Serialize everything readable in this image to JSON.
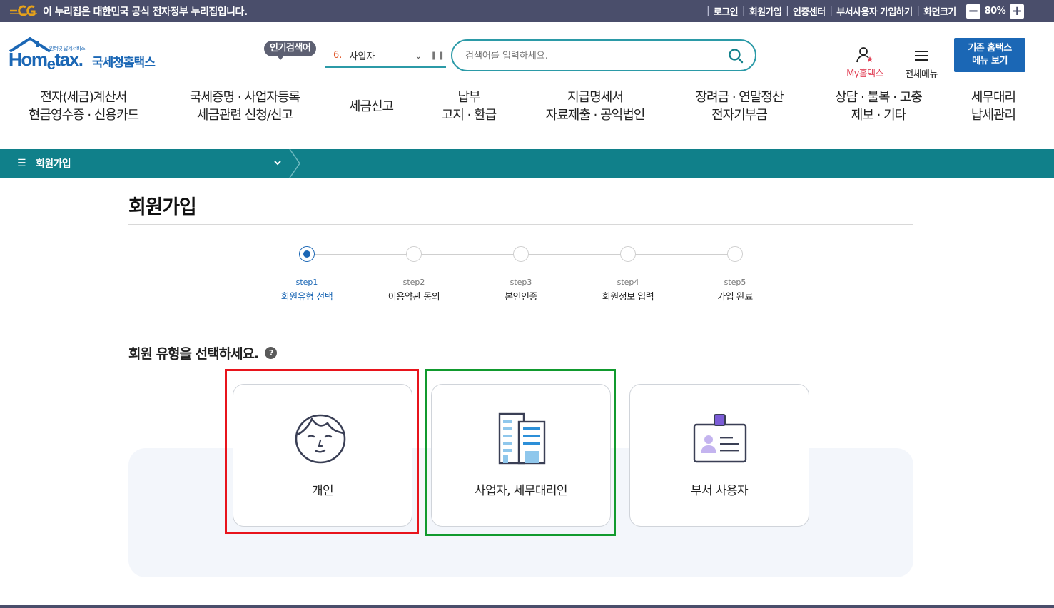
{
  "govbar": {
    "text": "이 누리집은 대한민국 공식 전자정부 누리집입니다.",
    "links": [
      "로그인",
      "회원가입",
      "인증센터",
      "부서사용자 가입하기",
      "화면크기"
    ],
    "zoom_minus": "−",
    "zoom_value": "80%",
    "zoom_plus": "+"
  },
  "logo": {
    "tagline": "인터넷 납세서비스",
    "brand_main": "Hom",
    "brand_e": "e",
    "brand_rest": "tax.",
    "brand_kor": "국세청홈택스"
  },
  "popular": {
    "badge": "인기검색어",
    "rank": "6.",
    "keyword": "사업자"
  },
  "search": {
    "placeholder": "검색어를 입력하세요."
  },
  "header": {
    "my_label": "My홈택스",
    "all_menu_label": "전체메뉴",
    "legacy_line1": "기존 홈택스",
    "legacy_line2": "메뉴 보기"
  },
  "gnb": [
    {
      "line1": "전자(세금)계산서",
      "line2": "현금영수증 · 신용카드"
    },
    {
      "line1": "국세증명 · 사업자등록",
      "line2": "세금관련 신청/신고"
    },
    {
      "line1": "세금신고",
      "line2": ""
    },
    {
      "line1": "납부",
      "line2": "고지 · 환급"
    },
    {
      "line1": "지급명세서",
      "line2": "자료제출 · 공익법인"
    },
    {
      "line1": "장려금 · 연말정산",
      "line2": "전자기부금"
    },
    {
      "line1": "상담 · 불복 · 고충",
      "line2": "제보 · 기타"
    },
    {
      "line1": "세무대리",
      "line2": "납세관리"
    }
  ],
  "location": {
    "current": "회원가입"
  },
  "page": {
    "title": "회원가입",
    "select_heading": "회원 유형을 선택하세요.",
    "help": "?"
  },
  "steps": [
    {
      "num": "step1",
      "name": "회원유형 선택",
      "active": true
    },
    {
      "num": "step2",
      "name": "이용약관 동의",
      "active": false
    },
    {
      "num": "step3",
      "name": "본인인증",
      "active": false
    },
    {
      "num": "step4",
      "name": "회원정보 입력",
      "active": false
    },
    {
      "num": "step5",
      "name": "가입 완료",
      "active": false
    }
  ],
  "cards": [
    {
      "label": "개인",
      "icon": "face-icon"
    },
    {
      "label": "사업자, 세무대리인",
      "icon": "building-icon"
    },
    {
      "label": "부서 사용자",
      "icon": "id-badge-icon"
    }
  ],
  "colors": {
    "govbar": "#4a4e6b",
    "teal": "#10808a",
    "brand_blue": "#1b67b5",
    "highlight_red": "#e8141c",
    "highlight_green": "#119a2e"
  }
}
